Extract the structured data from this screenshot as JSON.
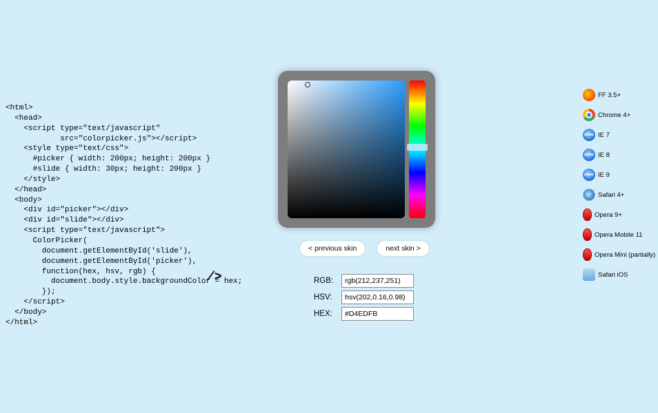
{
  "code": "<html>\n  <head>\n    <script type=\"text/javascript\"\n            src=\"colorpicker.js\"></script>\n    <style type=\"text/css\">\n      #picker { width: 200px; height: 200px }\n      #slide { width: 30px; height: 200px }\n    </style>\n  </head>\n  <body>\n    <div id=\"picker\"></div>\n    <div id=\"slide\"></div>\n    <script type=\"text/javascript\">\n      ColorPicker(\n        document.getElementById('slide'),\n        document.getElementById('picker'),\n        function(hex, hsv, rgb) {\n          document.body.style.backgroundColor = hex;\n        });\n    </script>\n  </body>\n</html>",
  "closeTag": "/>",
  "buttons": {
    "prev": "< previous skin",
    "next": "next skin >"
  },
  "labels": {
    "rgb": "RGB:",
    "hsv": "HSV:",
    "hex": "HEX:"
  },
  "values": {
    "rgb": "rgb(212,237,251)",
    "hsv": "hsv(202,0.16,0.98)",
    "hex": "#D4EDFB"
  },
  "browsers": [
    {
      "label": "FF 3.5+",
      "icon": "ic-ff"
    },
    {
      "label": "Chrome 4+",
      "icon": "ic-ch"
    },
    {
      "label": "IE 7",
      "icon": "ic-ie"
    },
    {
      "label": "IE 8",
      "icon": "ic-ie"
    },
    {
      "label": "IE 9",
      "icon": "ic-ie"
    },
    {
      "label": "Safari 4+",
      "icon": "ic-sf"
    },
    {
      "label": "Opera 9+",
      "icon": "ic-op"
    },
    {
      "label": "Opera Mobile 11",
      "icon": "ic-op"
    },
    {
      "label": "Opera Mini (partially)",
      "icon": "ic-op"
    },
    {
      "label": "Safari iOS",
      "icon": "ic-si"
    }
  ]
}
